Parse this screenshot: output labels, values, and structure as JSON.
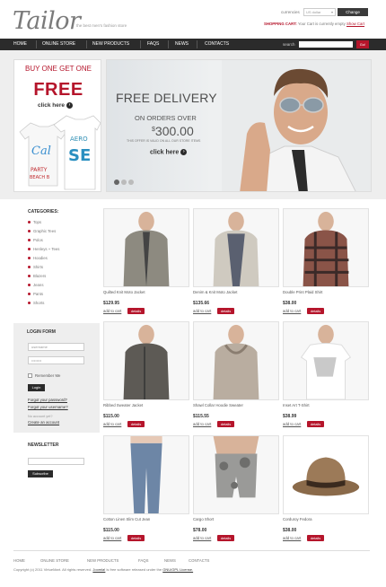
{
  "header": {
    "logo": "Tailor",
    "tagline": "the best men's fashion store",
    "currency_label": "currencies",
    "currency_value": "US dollar",
    "change_button": "Change",
    "cart_label": "SHOPPING CART:",
    "cart_text": "Your Cart is currently empty",
    "cart_link": "Show Cart"
  },
  "nav": {
    "items": [
      "HOME",
      "ONLINE STORE",
      "NEW PRODUCTS",
      "FAQS",
      "NEWS",
      "CONTACTS"
    ],
    "search_label": "search",
    "search_button": "Go!"
  },
  "banner_left": {
    "line1": "BUY ONE GET ONE",
    "line2": "FREE",
    "click": "click here",
    "shirt_text": [
      "Cal",
      "AERO",
      "SE",
      "PARTY",
      "BEACH B"
    ]
  },
  "banner_main": {
    "title": "FREE DELIVERY",
    "orders": "ON ORDERS OVER",
    "price": "300.00",
    "currency_symbol": "$",
    "note": "THIS OFFER IS VALID ON ALL OUR STORE ITEMS",
    "click": "click here"
  },
  "categories": {
    "title": "CATEGORIES:",
    "items": [
      "Tops",
      "Graphic Tees",
      "Polos",
      "Henleys + Tees",
      "Hoodies",
      "Shirts",
      "Blazers",
      "Jeans",
      "Pants",
      "Shorts"
    ]
  },
  "login": {
    "title": "LOGIN FORM",
    "username_placeholder": "username",
    "password_placeholder": "••••••••",
    "remember": "Remember Me",
    "button": "Login",
    "forgot_password": "Forgot your password?",
    "forgot_username": "Forgot your username?",
    "no_account": "No account yet?",
    "create": "Create an account"
  },
  "newsletter": {
    "title": "NEWSLETTER",
    "button": "Subscribe"
  },
  "products": [
    {
      "name": "Quilted Knit Moto Jacket",
      "price": "$129.95",
      "add": "add to cart",
      "details": "details"
    },
    {
      "name": "Denim & Knit Moto Jacket",
      "price": "$135.66",
      "add": "add to cart",
      "details": "details"
    },
    {
      "name": "Double Print Plaid Shirt",
      "price": "$38.00",
      "add": "add to cart",
      "details": "details"
    },
    {
      "name": "Ribbed Sweater Jacket",
      "price": "$115.00",
      "add": "add to cart",
      "details": "details"
    },
    {
      "name": "Shawl Collar Hoodie Sweater",
      "price": "$115.55",
      "add": "add to cart",
      "details": "details"
    },
    {
      "name": "Inset Art T-Shirt",
      "price": "$38.99",
      "add": "add to cart",
      "details": "details"
    },
    {
      "name": "Cotton Linen Slim Cut Jean",
      "price": "$115.00",
      "add": "add to cart",
      "details": "details"
    },
    {
      "name": "Cargo Short",
      "price": "$78.00",
      "add": "add to cart",
      "details": "details"
    },
    {
      "name": "Corduroy Fedora",
      "price": "$38.00",
      "add": "add to cart",
      "details": "details"
    }
  ],
  "footer": {
    "nav": [
      "HOME",
      "ONLINE STORE",
      "NEW PRODUCTS",
      "FAQS",
      "NEWS",
      "CONTACTS"
    ],
    "copy_prefix": "Copyright (c) 2011 VirtueMart. All rights reserved.",
    "joomla": "Joomla!",
    "copy_mid": "is free software released under the",
    "license": "GNU/GPL License."
  },
  "colors": {
    "accent": "#b5152b",
    "nav_bg": "#2b2b2b",
    "panel_bg": "#eeeeee"
  }
}
